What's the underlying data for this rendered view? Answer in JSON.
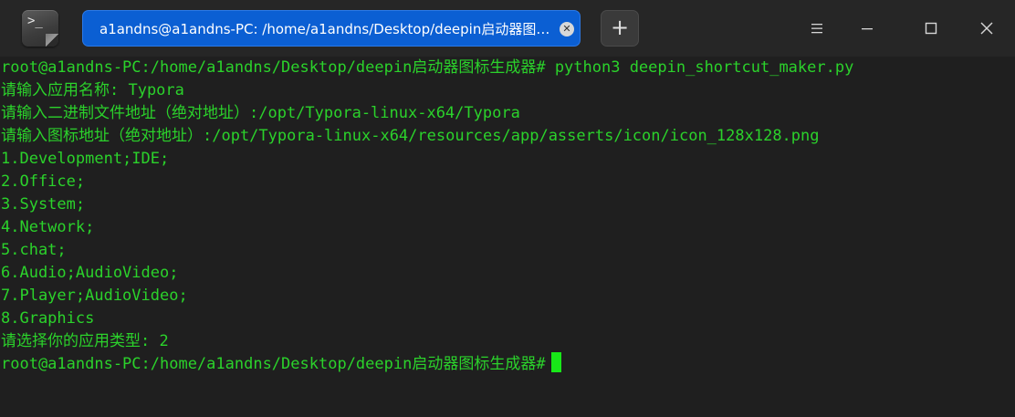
{
  "tab": {
    "title": "a1andns@a1andns-PC: /home/a1andns/Desktop/deepin启动器图…",
    "close_icon": "close-icon"
  },
  "new_tab_label": "+",
  "window_controls": {
    "menu_icon": "menu-icon",
    "minimize_icon": "minimize-icon",
    "maximize_icon": "maximize-icon",
    "close_icon": "close-icon"
  },
  "terminal": {
    "prompt": "root@a1andns-PC:/home/a1andns/Desktop/deepin启动器图标生成器#",
    "command": " python3 deepin_shortcut_maker.py",
    "lines": [
      "请输入应用名称: Typora",
      "请输入二进制文件地址（绝对地址）:/opt/Typora-linux-x64/Typora",
      "请输入图标地址（绝对地址）:/opt/Typora-linux-x64/resources/app/asserts/icon/icon_128x128.png",
      "1.Development;IDE;",
      "2.Office;",
      "3.System;",
      "4.Network;",
      "5.chat;",
      "6.Audio;AudioVideo;",
      "7.Player;AudioVideo;",
      "8.Graphics",
      "请选择你的应用类型: 2"
    ],
    "final_prompt": "root@a1andns-PC:/home/a1andns/Desktop/deepin启动器图标生成器#"
  },
  "colors": {
    "background": "#1f1f1f",
    "titlebar": "#262626",
    "text_green": "#2bd22b",
    "tab_blue": "#0b5fd3",
    "cursor": "#18e818"
  }
}
